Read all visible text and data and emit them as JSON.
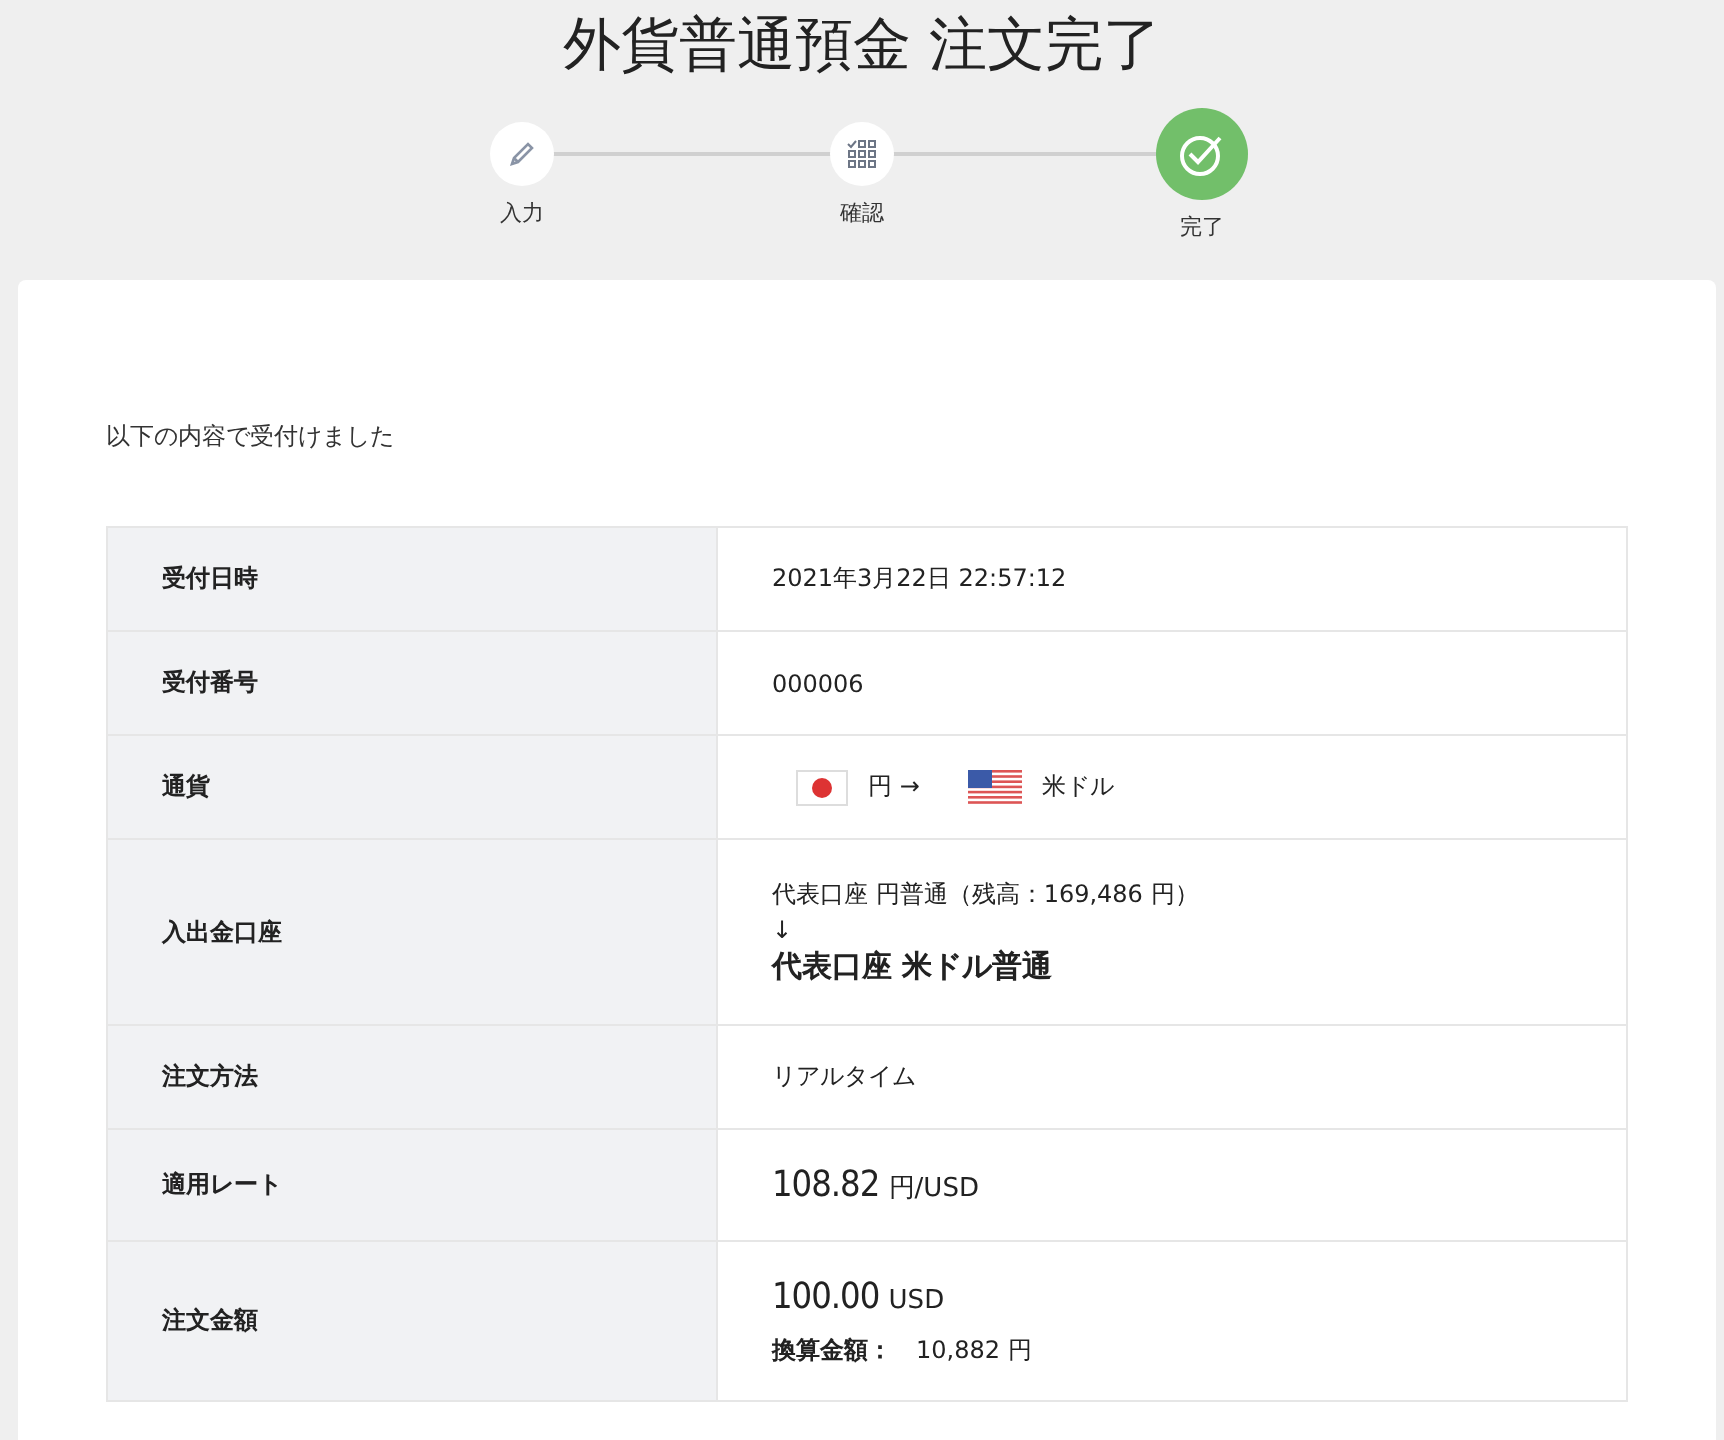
{
  "title": "外貨普通預金 注文完了",
  "steps": [
    {
      "label": "入力",
      "kind": "input",
      "selected": false
    },
    {
      "label": "確認",
      "kind": "confirm",
      "selected": false
    },
    {
      "label": "完了",
      "kind": "complete",
      "selected": true
    }
  ],
  "message": "以下の内容で受付けました",
  "rows": [
    {
      "kind": "text",
      "label": "受付日時",
      "value": "2021年3月22日 22:57:12"
    },
    {
      "kind": "text",
      "label": "受付番号",
      "value": "000006"
    },
    {
      "kind": "currency",
      "label": "通貨",
      "from": "円 →",
      "to": "米ドル"
    },
    {
      "kind": "account",
      "label": "入出金口座",
      "from": "代表口座 円普通（残高：169,486 円）",
      "arrow": "↓",
      "to": "代表口座 米ドル普通"
    },
    {
      "kind": "text",
      "label": "注文方法",
      "value": "リアルタイム"
    },
    {
      "kind": "rate",
      "label": "適用レート",
      "number": "108.82",
      "unit": "円/USD"
    },
    {
      "kind": "amount",
      "label": "注文金額",
      "number": "100.00",
      "unit": "USD",
      "sub_label": "換算金額：",
      "sub_value": "10,882",
      "sub_unit": "円"
    }
  ]
}
